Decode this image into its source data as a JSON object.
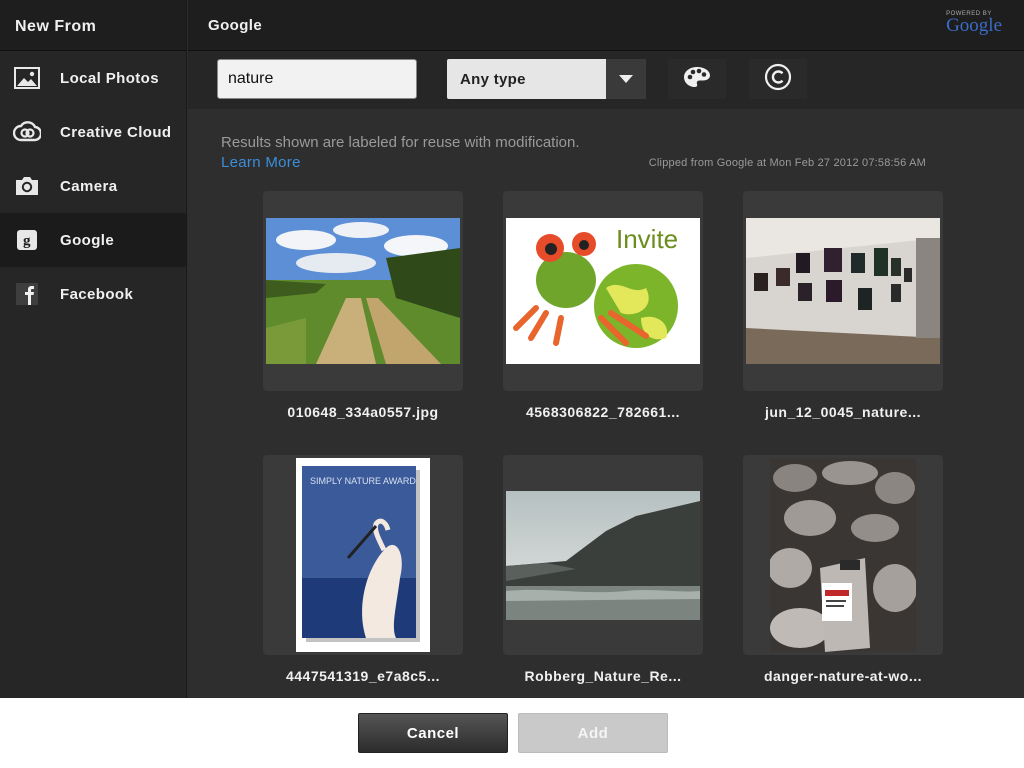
{
  "sidebar": {
    "title": "New From",
    "items": [
      {
        "label": "Local Photos",
        "icon": "photo-icon"
      },
      {
        "label": "Creative Cloud",
        "icon": "creative-cloud-icon"
      },
      {
        "label": "Camera",
        "icon": "camera-icon"
      },
      {
        "label": "Google",
        "icon": "google-icon",
        "active": true
      },
      {
        "label": "Facebook",
        "icon": "facebook-icon"
      }
    ]
  },
  "header": {
    "title": "Google",
    "powered_by": "POWERED BY",
    "powered_brand": "Google"
  },
  "toolbar": {
    "search_value": "nature",
    "type_select": "Any type",
    "color_filter_icon": "palette-icon",
    "usage_rights_icon": "copyright-icon"
  },
  "content": {
    "notice": "Results shown are labeled for reuse with modification.",
    "learn_more": "Learn More",
    "clipped": "Clipped from Google at Mon Feb 27 2012 07:58:56 AM"
  },
  "results": [
    {
      "caption": "010648_334a0557.jpg"
    },
    {
      "caption": "4568306822_782661..."
    },
    {
      "caption": "jun_12_0045_nature..."
    },
    {
      "caption": "4447541319_e7a8c5..."
    },
    {
      "caption": "Robberg_Nature_Re..."
    },
    {
      "caption": "danger-nature-at-wo..."
    }
  ],
  "thumbnail_texts": {
    "invite": "Invite",
    "award": "SIMPLY NATURE AWARD"
  },
  "footer": {
    "cancel_label": "Cancel",
    "add_label": "Add"
  },
  "colors": {
    "link": "#3b8ed8",
    "sidebar_bg": "#262626",
    "content_bg": "#2e2e2e"
  }
}
